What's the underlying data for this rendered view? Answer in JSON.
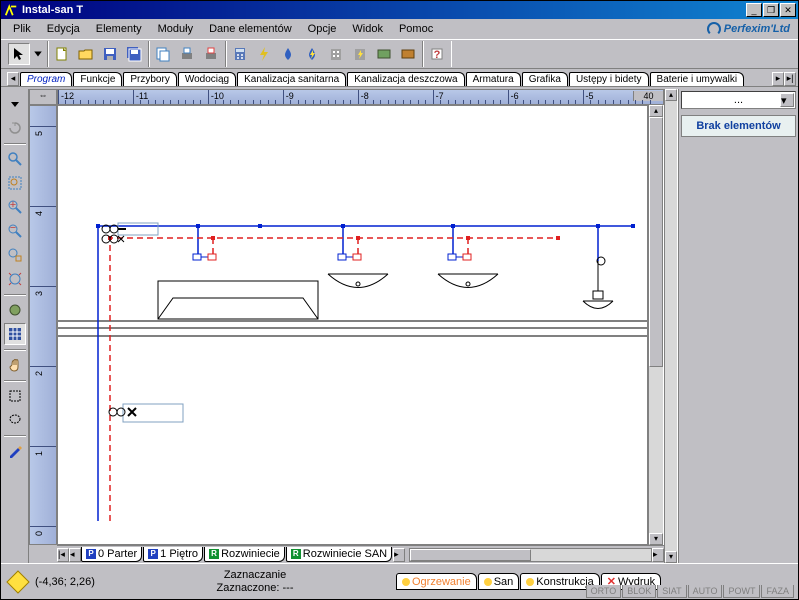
{
  "window": {
    "title": "Instal-san T"
  },
  "menu": [
    "Plik",
    "Edycja",
    "Elementy",
    "Moduły",
    "Dane elementów",
    "Opcje",
    "Widok",
    "Pomoc"
  ],
  "brand": "Perfexim'Ltd",
  "category_tabs": [
    "Program",
    "Funkcje",
    "Przybory",
    "Wodociąg",
    "Kanalizacja sanitarna",
    "Kanalizacja deszczowa",
    "Armatura",
    "Grafika",
    "Ustępy i bidety",
    "Baterie i umywalki"
  ],
  "h_ruler": {
    "labels": [
      "-12",
      "-11",
      "-10",
      "-9",
      "-8",
      "-7",
      "-6",
      "-5"
    ],
    "origin": "40"
  },
  "v_ruler": {
    "labels": [
      "5",
      "4",
      "3",
      "2",
      "1",
      "0"
    ]
  },
  "rightpanel": {
    "combo": "...",
    "msg": "Brak elementów"
  },
  "bottom_tabs": [
    {
      "badge": "P",
      "color": "#2040c0",
      "label": "0 Parter"
    },
    {
      "badge": "P",
      "color": "#2040c0",
      "label": "1 Piętro"
    },
    {
      "badge": "R",
      "color": "#109030",
      "label": "Rozwiniecie"
    },
    {
      "badge": "R",
      "color": "#109030",
      "label": "Rozwiniecie SAN"
    }
  ],
  "status": {
    "coords": "(-4,36; 2,26)",
    "mode_line1": "Zaznaczanie",
    "mode_line2": "Zaznaczone: ---",
    "layers": [
      {
        "name": "Ogrzewanie",
        "color": "#f08030",
        "dot": "#ffd040"
      },
      {
        "name": "San",
        "color": "#000",
        "dot": "#ffd040"
      },
      {
        "name": "Konstrukcja",
        "color": "#000",
        "dot": "#ffd040"
      },
      {
        "name": "Wydruk",
        "color": "#000",
        "dot": "#e03030",
        "x": true
      }
    ],
    "modes": [
      "ORTO",
      "BLOK",
      "SIAT",
      "AUTO",
      "POWT",
      "FAZA"
    ]
  }
}
